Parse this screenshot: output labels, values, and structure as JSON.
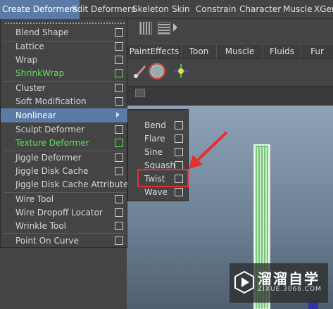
{
  "menubar": {
    "items": [
      "Create Deformers",
      "Edit Deformers",
      "Skeleton",
      "Skin",
      "Constrain",
      "Character",
      "Muscle",
      "XGen"
    ]
  },
  "shelf": {
    "tabs": [
      "PaintEffects",
      "Toon",
      "Muscle",
      "Fluids",
      "Fur"
    ]
  },
  "menu": {
    "items": [
      {
        "label": "Blend Shape",
        "option": true
      },
      {
        "label": "Lattice",
        "option": true
      },
      {
        "label": "Wrap",
        "option": true
      },
      {
        "label": "ShrinkWrap",
        "option": true,
        "highlight_color": "green"
      },
      {
        "label": "Cluster",
        "option": true
      },
      {
        "label": "Soft Modification",
        "option": true
      },
      {
        "label": "Nonlinear",
        "submenu": true,
        "active": true
      },
      {
        "label": "Sculpt Deformer",
        "option": true
      },
      {
        "label": "Texture Deformer",
        "option": true,
        "highlight_color": "green"
      },
      {
        "label": "Jiggle Deformer",
        "option": true
      },
      {
        "label": "Jiggle Disk Cache",
        "option": true
      },
      {
        "label": "Jiggle Disk Cache Attributes",
        "option": false
      },
      {
        "label": "Wire Tool",
        "option": true
      },
      {
        "label": "Wire Dropoff Locator",
        "option": true
      },
      {
        "label": "Wrinkle Tool",
        "option": true
      },
      {
        "label": "Point On Curve",
        "option": true
      }
    ]
  },
  "submenu": {
    "items": [
      {
        "label": "Bend"
      },
      {
        "label": "Flare"
      },
      {
        "label": "Sine"
      },
      {
        "label": "Squash"
      },
      {
        "label": "Twist",
        "annotated": true
      },
      {
        "label": "Wave"
      }
    ]
  },
  "watermark": {
    "title": "溜溜自学",
    "url": "ZIXUE.3066.COM"
  },
  "colors": {
    "menu_highlight": "#5b7ba7",
    "green_text": "#5fe05f",
    "annotation": "#e53030"
  }
}
